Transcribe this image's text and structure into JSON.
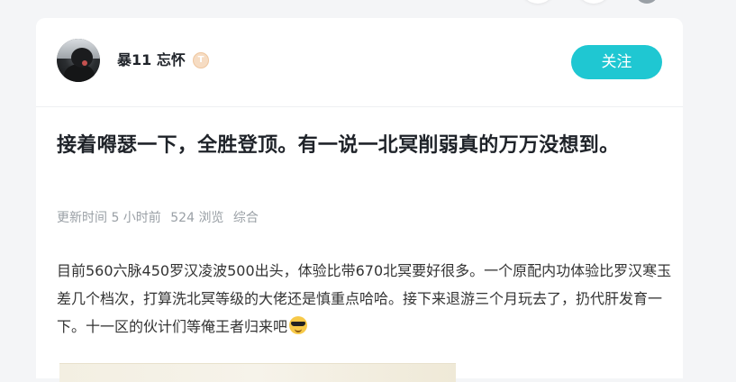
{
  "author": {
    "name": "暴11 忘怀",
    "badge_text": "T"
  },
  "follow_label": "关注",
  "post": {
    "title": "接着嘚瑟一下，全胜登顶。有一说一北冥削弱真的万万没想到。",
    "meta": {
      "updated": "更新时间 5 小时前",
      "views": "524 浏览",
      "category": "综合"
    },
    "body": "目前560六脉450罗汉凌波500出头，体验比带670北冥要好很多。一个原配内功体验比罗汉寒玉差几个档次，打算洗北冥等级的大佬还是慎重点哈哈。接下来退游三个月玩去了，扔代肝发育一下。十一区的伙计们等俺王者归来吧",
    "emoji": "sunglasses-emoji"
  },
  "colors": {
    "accent": "#1fc7d2",
    "title": "#1f2329",
    "meta": "#9aa0a6",
    "body": "#333333",
    "page_bg": "#f4f5f7"
  }
}
